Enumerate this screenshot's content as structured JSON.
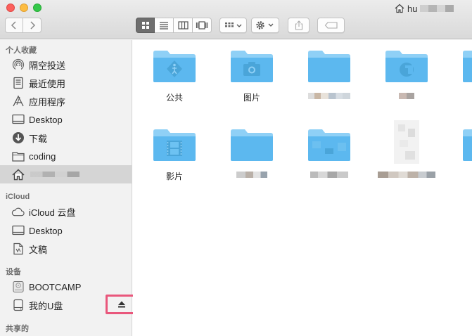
{
  "window": {
    "title": "hu"
  },
  "toolbar": {
    "back": "back",
    "forward": "forward",
    "views": [
      "icon-view",
      "list-view",
      "column-view",
      "cover-flow-view"
    ],
    "arrange": "arrange",
    "action": "action",
    "share": "share",
    "tags": "tags"
  },
  "sidebar": {
    "favorites_header": "个人收藏",
    "favorites": [
      {
        "label": "隔空投送",
        "icon": "airdrop-icon"
      },
      {
        "label": "最近使用",
        "icon": "recents-icon"
      },
      {
        "label": "应用程序",
        "icon": "applications-icon"
      },
      {
        "label": "Desktop",
        "icon": "desktop-icon"
      },
      {
        "label": "下载",
        "icon": "downloads-icon"
      },
      {
        "label": "coding",
        "icon": "folder-icon"
      },
      {
        "label": "",
        "icon": "home-icon"
      }
    ],
    "icloud_header": "iCloud",
    "icloud": [
      {
        "label": "iCloud 云盘",
        "icon": "cloud-icon"
      },
      {
        "label": "Desktop",
        "icon": "desktop-icon"
      },
      {
        "label": "文稿",
        "icon": "documents-icon"
      }
    ],
    "devices_header": "设备",
    "devices": [
      {
        "label": "BOOTCAMP",
        "icon": "disk-icon"
      },
      {
        "label": "我的U盘",
        "icon": "usb-disk-icon"
      }
    ],
    "shared_header": "共享的"
  },
  "files": [
    {
      "name": "公共",
      "icon": "public-folder-icon"
    },
    {
      "name": "图片",
      "icon": "pictures-folder-icon"
    },
    {
      "name": "",
      "icon": "folder-icon"
    },
    {
      "name": "",
      "icon": "library-folder-icon"
    },
    {
      "name": "",
      "icon": "folder-icon"
    },
    {
      "name": "影片",
      "icon": "movies-folder-icon"
    },
    {
      "name": "",
      "icon": "folder-icon"
    },
    {
      "name": "",
      "icon": "folder-icon"
    },
    {
      "name": "",
      "icon": "document-icon"
    },
    {
      "name": "",
      "icon": "folder-icon"
    }
  ],
  "colors": {
    "folder": "#5cb8ef",
    "folder_tab": "#8fd0f6",
    "highlight": "#e9577c",
    "selected_row": "#d5d5d5"
  }
}
